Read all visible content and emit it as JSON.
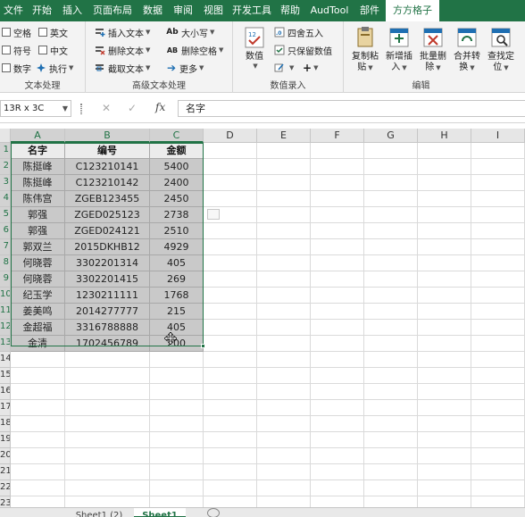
{
  "menu": {
    "tabs": [
      "文件",
      "开始",
      "插入",
      "页面布局",
      "数据",
      "审阅",
      "视图",
      "开发工具",
      "帮助",
      "AudTool",
      "部件",
      "方方格子"
    ],
    "active_tab": "方方格子"
  },
  "ribbon": {
    "group_text": {
      "label": "文本处理",
      "options": [
        "空格",
        "英文",
        "符号",
        "中文",
        "数字",
        "执行"
      ]
    },
    "group_adv": {
      "label": "高级文本处理",
      "insert_text": "插入文本",
      "delete_text": "删除文本",
      "extract_text": "截取文本",
      "case": "大小写",
      "delete_space": "删除空格",
      "more": "更多",
      "case_icon": "Ab",
      "delete_space_icon": "AB"
    },
    "group_num": {
      "label": "数值录入",
      "value": "数值",
      "round": "四舍五入",
      "keep_value": "只保留数值"
    },
    "group_edit": {
      "label": "编辑",
      "buttons": [
        {
          "line1": "复制粘",
          "line2": "贴"
        },
        {
          "line1": "新增插",
          "line2": "入"
        },
        {
          "line1": "批量删",
          "line2": "除"
        },
        {
          "line1": "合并转",
          "line2": "换"
        },
        {
          "line1": "查找定",
          "line2": "位"
        }
      ]
    }
  },
  "formula_bar": {
    "name_box": "13R x 3C",
    "fx": "fx",
    "content": "名字"
  },
  "grid": {
    "columns": [
      "A",
      "B",
      "C",
      "D",
      "E",
      "F",
      "G",
      "H",
      "I"
    ],
    "rows": [
      "1",
      "2",
      "3",
      "4",
      "5",
      "6",
      "7",
      "8",
      "9",
      "10",
      "11",
      "12",
      "13",
      "14",
      "15",
      "16",
      "17",
      "18",
      "19",
      "20",
      "21",
      "22",
      "23"
    ],
    "header": [
      "名字",
      "编号",
      "金额"
    ],
    "data": [
      [
        "陈挺峰",
        "C123210141",
        "5400"
      ],
      [
        "陈挺峰",
        "C123210142",
        "2400"
      ],
      [
        "陈伟宫",
        "ZGEB123455",
        "2450"
      ],
      [
        "郭强",
        "ZGED025123",
        "2738"
      ],
      [
        "郭强",
        "ZGED024121",
        "2510"
      ],
      [
        "郭双兰",
        "2015DKHB12",
        "4929"
      ],
      [
        "何晓蓉",
        "3302201314",
        "405"
      ],
      [
        "何晓蓉",
        "3302201415",
        "269"
      ],
      [
        "纪玉学",
        "1230211111",
        "1768"
      ],
      [
        "姜美鸣",
        "2014277777",
        "215"
      ],
      [
        "金超福",
        "3316788888",
        "405"
      ],
      [
        "金清",
        "1702456789",
        "200"
      ]
    ]
  },
  "sheets": {
    "tabs": [
      "Sheet1 (2)",
      "Sheet1"
    ],
    "active": "Sheet1"
  },
  "colors": {
    "accent": "#217346",
    "selection_fill": "#c9c9c9"
  }
}
